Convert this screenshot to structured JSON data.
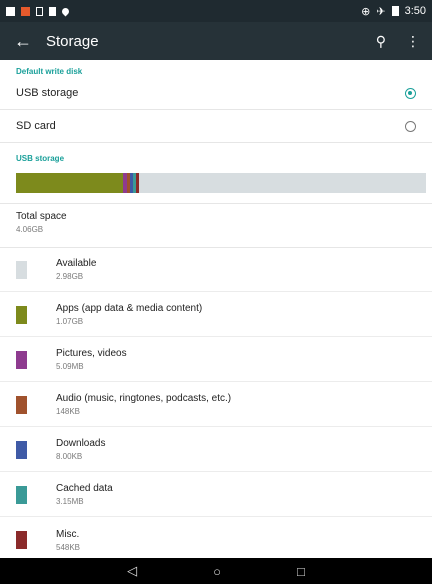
{
  "status_bar": {
    "time": "3:50",
    "left_icons": [
      "notification-icon",
      "app-icon",
      "usb-icon",
      "sd-icon",
      "location-icon"
    ],
    "right_icons": [
      "signal-icon",
      "airplane-icon",
      "battery-icon"
    ]
  },
  "app_bar": {
    "title": "Storage",
    "back_icon": "arrow-left-icon",
    "search_icon": "search-icon",
    "menu_icon": "more-vert-icon"
  },
  "default_write_disk": {
    "header": "Default write disk",
    "options": [
      {
        "label": "USB storage",
        "selected": true
      },
      {
        "label": "SD card",
        "selected": false
      }
    ]
  },
  "usb_storage": {
    "header": "USB storage",
    "total_label": "Total space",
    "total_value": "4.06GB",
    "items": [
      {
        "label": "Available",
        "size": "2.98GB",
        "color": "#d7dde0"
      },
      {
        "label": "Apps (app data & media content)",
        "size": "1.07GB",
        "color": "#7d8a1c"
      },
      {
        "label": "Pictures, videos",
        "size": "5.09MB",
        "color": "#8e3b8f"
      },
      {
        "label": "Audio (music, ringtones, podcasts, etc.)",
        "size": "148KB",
        "color": "#a0522d"
      },
      {
        "label": "Downloads",
        "size": "8.00KB",
        "color": "#3f5aa6"
      },
      {
        "label": "Cached data",
        "size": "3.15MB",
        "color": "#3a9a97"
      },
      {
        "label": "Misc.",
        "size": "548KB",
        "color": "#8b2a2a"
      }
    ]
  },
  "nav_bar": {
    "back": "◁",
    "home": "○",
    "recents": "□"
  }
}
